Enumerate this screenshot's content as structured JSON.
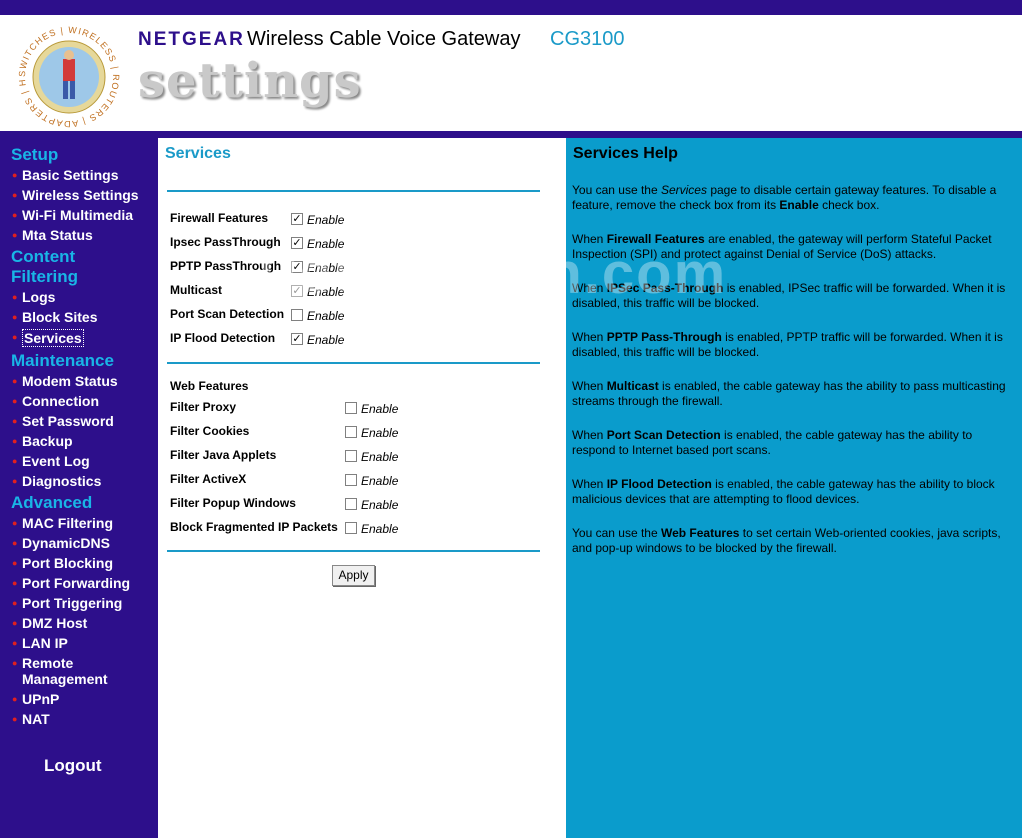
{
  "header": {
    "brand": "NETGEAR",
    "product": "Wireless Cable Voice Gateway",
    "model": "CG3100",
    "settings_word": "settings",
    "logo_ring": "SWITCHES | WIRELESS | ROUTERS | ADAPTERS | HUBS"
  },
  "sidebar": {
    "sections": [
      {
        "title": "Setup",
        "items": [
          "Basic Settings",
          "Wireless Settings",
          "Wi-Fi Multimedia",
          "Mta Status"
        ]
      },
      {
        "title": "Content Filtering",
        "items": [
          "Logs",
          "Block Sites",
          "Services"
        ]
      },
      {
        "title": "Maintenance",
        "items": [
          "Modem Status",
          "Connection",
          "Set Password",
          "Backup",
          "Event Log",
          "Diagnostics"
        ]
      },
      {
        "title": "Advanced",
        "items": [
          "MAC Filtering",
          "DynamicDNS",
          "Port Blocking",
          "Port Forwarding",
          "Port Triggering",
          "DMZ Host",
          "LAN IP",
          "Remote Management",
          "UPnP",
          "NAT"
        ]
      }
    ],
    "active": "Services",
    "logout": "Logout"
  },
  "main": {
    "title": "Services",
    "enable_label": "Enable",
    "firewall": [
      {
        "label": "Firewall Features",
        "checked": true,
        "disabled": false
      },
      {
        "label": "Ipsec PassThrough",
        "checked": true,
        "disabled": false
      },
      {
        "label": "PPTP PassThrough",
        "checked": true,
        "disabled": false
      },
      {
        "label": "Multicast",
        "checked": true,
        "disabled": true
      },
      {
        "label": "Port Scan Detection",
        "checked": false,
        "disabled": false
      },
      {
        "label": "IP Flood Detection",
        "checked": true,
        "disabled": false
      }
    ],
    "web_features_title": "Web Features",
    "web": [
      {
        "label": "Filter Proxy",
        "checked": false
      },
      {
        "label": "Filter Cookies",
        "checked": false
      },
      {
        "label": "Filter Java Applets",
        "checked": false
      },
      {
        "label": "Filter ActiveX",
        "checked": false
      },
      {
        "label": "Filter Popup Windows",
        "checked": false
      },
      {
        "label": "Block Fragmented IP Packets",
        "checked": false
      }
    ],
    "apply_label": "Apply"
  },
  "help": {
    "title": "Services Help",
    "paragraphs": [
      [
        "You can use the ",
        {
          "i": "Services"
        },
        " page to disable certain gateway features. To disable a feature, remove the check box from its ",
        {
          "b": "Enable"
        },
        " check box."
      ],
      [
        "When ",
        {
          "b": "Firewall Features"
        },
        " are enabled, the gateway will perform Stateful Packet Inspection (SPI) and protect against Denial of Service (DoS) attacks."
      ],
      [
        "When ",
        {
          "b": "IPSec Pass-Through"
        },
        " is enabled, IPSec traffic will be forwarded. When it is disabled, this traffic will be blocked."
      ],
      [
        "When ",
        {
          "b": "PPTP Pass-Through"
        },
        " is enabled, PPTP traffic will be forwarded. When it is disabled, this traffic will be blocked."
      ],
      [
        "When ",
        {
          "b": "Multicast"
        },
        " is enabled, the cable gateway has the ability to pass multicasting streams through the firewall."
      ],
      [
        "When ",
        {
          "b": "Port Scan Detection"
        },
        " is enabled, the cable gateway has the ability to respond to Internet based port scans."
      ],
      [
        "When ",
        {
          "b": "IP Flood Detection"
        },
        " is enabled, the cable gateway has the ability to block malicious devices that are attempting to flood devices."
      ],
      [
        "You can use the ",
        {
          "b": "Web Features"
        },
        " to set certain Web-oriented cookies, java scripts, and pop-up windows to be blocked by the firewall."
      ]
    ]
  },
  "watermark": "PcWinTech.com",
  "colors": {
    "nav_bg": "#2d0f8b",
    "accent": "#1a9ac8",
    "help_bg": "#0a9ccc",
    "bullet": "#e0201f",
    "section_title": "#19b5e6"
  }
}
